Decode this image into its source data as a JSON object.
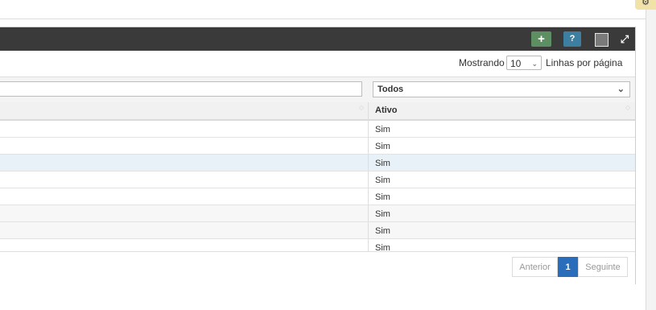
{
  "header": {
    "add_label": "+",
    "help_label": "?",
    "expand_label": "⤢"
  },
  "length": {
    "prefix": "Mostrando",
    "value": "10",
    "suffix": "Linhas por página"
  },
  "filters": {
    "text_value": "",
    "ativo_selected": "Todos"
  },
  "table": {
    "columns": [
      "Ativo"
    ],
    "rows": [
      "Sim",
      "Sim",
      "Sim",
      "Sim",
      "Sim",
      "Sim",
      "Sim",
      "Sim"
    ],
    "highlighted_row": 2
  },
  "pagination": {
    "prev": "Anterior",
    "current": "1",
    "next": "Seguinte"
  },
  "colors": {
    "header_bg": "#3a3a3a",
    "add_button": "#5e8f62",
    "help_button": "#3d7fa0",
    "page_active": "#2a6ebb",
    "row_highlight": "#e9f1f8",
    "gear_tab": "#f0e2a8"
  }
}
